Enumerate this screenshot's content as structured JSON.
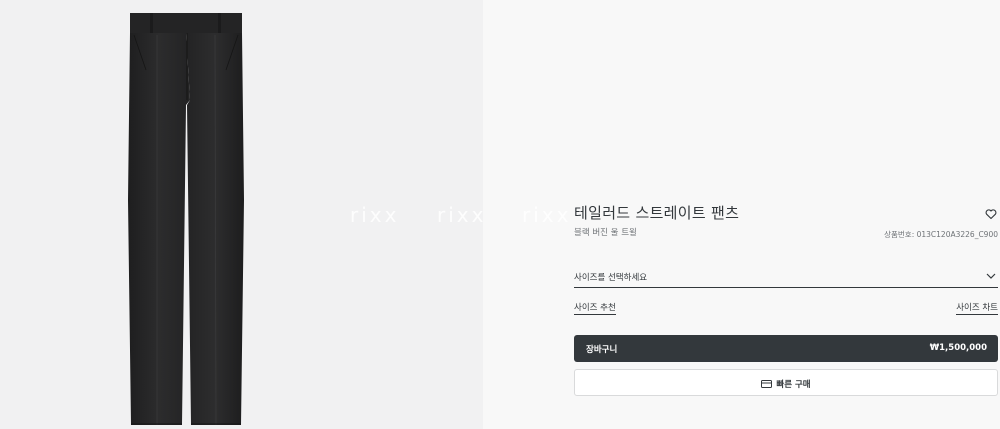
{
  "product": {
    "name": "테일러드 스트레이트 팬츠",
    "color": "블랙 버진 울 트윌",
    "sku": "상품번호: 013C120A3226_C900",
    "image_alt": "black tailored straight trousers"
  },
  "watermark": [
    "rixx",
    "rixx",
    "rixx"
  ],
  "size": {
    "placeholder": "사이즈를 선택하세요"
  },
  "links": {
    "size_recommend": "사이즈 추천",
    "size_chart": "사이즈 차트"
  },
  "actions": {
    "cart_label": "장바구니",
    "cart_price": "₩1,500,000",
    "buy_now_label": "빠른 구매"
  },
  "icons": {
    "wishlist": "heart-icon",
    "dropdown": "chevron-down-icon",
    "buy_now": "credit-card-icon"
  },
  "colors": {
    "primary": "#33383c",
    "image_bg": "#f1f1f2",
    "panel_bg": "#f8f8f8"
  }
}
